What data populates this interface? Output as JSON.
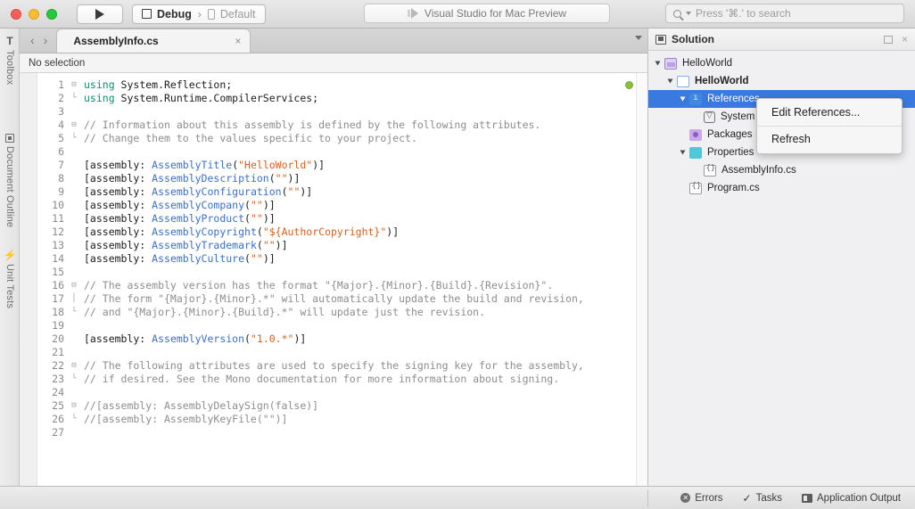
{
  "titlebar": {
    "window_controls": [
      "close",
      "minimize",
      "zoom"
    ],
    "run_button_label": "run",
    "run_icon": "play-icon",
    "configuration": "Debug",
    "config_separator": "›",
    "device": "Default",
    "app_title": "Visual Studio for Mac Preview",
    "app_icon": "visual-studio-icon",
    "search_placeholder": "Press '⌘.' to search",
    "search_icon": "search-icon"
  },
  "left_pads": [
    {
      "label": "Toolbox",
      "icon": "toolbox-icon",
      "glyph": "T"
    },
    {
      "label": "Document Outline",
      "icon": "document-outline-icon"
    },
    {
      "label": "Unit Tests",
      "icon": "unit-tests-icon",
      "glyph": "⚡"
    }
  ],
  "editor": {
    "nav_back": "‹",
    "nav_forward": "›",
    "tab_name": "AssemblyInfo.cs",
    "tab_close": "×",
    "tab_dropdown_icon": "chevron-down-icon",
    "selection_status": "No selection",
    "marker": "green-status-dot",
    "lines": [
      {
        "n": "1",
        "fold": "⊟",
        "tokens": [
          {
            "t": "using",
            "c": "k-using"
          },
          {
            "t": " System.Reflection;",
            "c": "k-plain"
          }
        ]
      },
      {
        "n": "2",
        "fold": "└",
        "tokens": [
          {
            "t": "using",
            "c": "k-using"
          },
          {
            "t": " System.Runtime.CompilerServices;",
            "c": "k-plain"
          }
        ]
      },
      {
        "n": "3",
        "fold": "",
        "tokens": []
      },
      {
        "n": "4",
        "fold": "⊟",
        "tokens": [
          {
            "t": "// Information about this assembly is defined by the following attributes.",
            "c": "k-cmt"
          }
        ]
      },
      {
        "n": "5",
        "fold": "└",
        "tokens": [
          {
            "t": "// Change them to the values specific to your project.",
            "c": "k-cmt"
          }
        ]
      },
      {
        "n": "6",
        "fold": "",
        "tokens": []
      },
      {
        "n": "7",
        "fold": "",
        "tokens": [
          {
            "t": "[assembly: ",
            "c": "k-plain"
          },
          {
            "t": "AssemblyTitle",
            "c": "k-type"
          },
          {
            "t": "(",
            "c": "k-plain"
          },
          {
            "t": "\"HelloWorld\"",
            "c": "k-str"
          },
          {
            "t": ")]",
            "c": "k-plain"
          }
        ]
      },
      {
        "n": "8",
        "fold": "",
        "tokens": [
          {
            "t": "[assembly: ",
            "c": "k-plain"
          },
          {
            "t": "AssemblyDescription",
            "c": "k-type"
          },
          {
            "t": "(",
            "c": "k-plain"
          },
          {
            "t": "\"\"",
            "c": "k-str"
          },
          {
            "t": ")]",
            "c": "k-plain"
          }
        ]
      },
      {
        "n": "9",
        "fold": "",
        "tokens": [
          {
            "t": "[assembly: ",
            "c": "k-plain"
          },
          {
            "t": "AssemblyConfiguration",
            "c": "k-type"
          },
          {
            "t": "(",
            "c": "k-plain"
          },
          {
            "t": "\"\"",
            "c": "k-str"
          },
          {
            "t": ")]",
            "c": "k-plain"
          }
        ]
      },
      {
        "n": "10",
        "fold": "",
        "tokens": [
          {
            "t": "[assembly: ",
            "c": "k-plain"
          },
          {
            "t": "AssemblyCompany",
            "c": "k-type"
          },
          {
            "t": "(",
            "c": "k-plain"
          },
          {
            "t": "\"\"",
            "c": "k-str"
          },
          {
            "t": ")]",
            "c": "k-plain"
          }
        ]
      },
      {
        "n": "11",
        "fold": "",
        "tokens": [
          {
            "t": "[assembly: ",
            "c": "k-plain"
          },
          {
            "t": "AssemblyProduct",
            "c": "k-type"
          },
          {
            "t": "(",
            "c": "k-plain"
          },
          {
            "t": "\"\"",
            "c": "k-str"
          },
          {
            "t": ")]",
            "c": "k-plain"
          }
        ]
      },
      {
        "n": "12",
        "fold": "",
        "tokens": [
          {
            "t": "[assembly: ",
            "c": "k-plain"
          },
          {
            "t": "AssemblyCopyright",
            "c": "k-type"
          },
          {
            "t": "(",
            "c": "k-plain"
          },
          {
            "t": "\"${AuthorCopyright}\"",
            "c": "k-str"
          },
          {
            "t": ")]",
            "c": "k-plain"
          }
        ]
      },
      {
        "n": "13",
        "fold": "",
        "tokens": [
          {
            "t": "[assembly: ",
            "c": "k-plain"
          },
          {
            "t": "AssemblyTrademark",
            "c": "k-type"
          },
          {
            "t": "(",
            "c": "k-plain"
          },
          {
            "t": "\"\"",
            "c": "k-str"
          },
          {
            "t": ")]",
            "c": "k-plain"
          }
        ]
      },
      {
        "n": "14",
        "fold": "",
        "tokens": [
          {
            "t": "[assembly: ",
            "c": "k-plain"
          },
          {
            "t": "AssemblyCulture",
            "c": "k-type"
          },
          {
            "t": "(",
            "c": "k-plain"
          },
          {
            "t": "\"\"",
            "c": "k-str"
          },
          {
            "t": ")]",
            "c": "k-plain"
          }
        ]
      },
      {
        "n": "15",
        "fold": "",
        "tokens": []
      },
      {
        "n": "16",
        "fold": "⊟",
        "tokens": [
          {
            "t": "// The assembly version has the format \"{Major}.{Minor}.{Build}.{Revision}\".",
            "c": "k-cmt"
          }
        ]
      },
      {
        "n": "17",
        "fold": "│",
        "tokens": [
          {
            "t": "// The form \"{Major}.{Minor}.*\" will automatically update the build and revision,",
            "c": "k-cmt"
          }
        ]
      },
      {
        "n": "18",
        "fold": "└",
        "tokens": [
          {
            "t": "// and \"{Major}.{Minor}.{Build}.*\" will update just the revision.",
            "c": "k-cmt"
          }
        ]
      },
      {
        "n": "19",
        "fold": "",
        "tokens": []
      },
      {
        "n": "20",
        "fold": "",
        "tokens": [
          {
            "t": "[assembly: ",
            "c": "k-plain"
          },
          {
            "t": "AssemblyVersion",
            "c": "k-type"
          },
          {
            "t": "(",
            "c": "k-plain"
          },
          {
            "t": "\"1.0.*\"",
            "c": "k-str"
          },
          {
            "t": ")]",
            "c": "k-plain"
          }
        ]
      },
      {
        "n": "21",
        "fold": "",
        "tokens": []
      },
      {
        "n": "22",
        "fold": "⊟",
        "tokens": [
          {
            "t": "// The following attributes are used to specify the signing key for the assembly,",
            "c": "k-cmt"
          }
        ]
      },
      {
        "n": "23",
        "fold": "└",
        "tokens": [
          {
            "t": "// if desired. See the Mono documentation for more information about signing.",
            "c": "k-cmt"
          }
        ]
      },
      {
        "n": "24",
        "fold": "",
        "tokens": []
      },
      {
        "n": "25",
        "fold": "⊟",
        "tokens": [
          {
            "t": "//[assembly: AssemblyDelaySign(false)]",
            "c": "k-cmt"
          }
        ]
      },
      {
        "n": "26",
        "fold": "└",
        "tokens": [
          {
            "t": "//[assembly: AssemblyKeyFile(\"\")]",
            "c": "k-cmt"
          }
        ]
      },
      {
        "n": "27",
        "fold": "",
        "tokens": []
      }
    ]
  },
  "solution": {
    "title": "Solution",
    "header_icon": "solution-icon",
    "dock_icon": "dock-icon",
    "close_icon": "close-icon",
    "tree": [
      {
        "label": "HelloWorld",
        "icon": "solution-node-icon",
        "indent": "ind1",
        "twist": true,
        "bold": false,
        "selected": false
      },
      {
        "label": "HelloWorld",
        "icon": "project-icon",
        "indent": "ind2",
        "twist": true,
        "bold": true,
        "selected": false
      },
      {
        "label": "References",
        "icon": "references-folder-icon",
        "indent": "ind3",
        "twist": true,
        "bold": false,
        "selected": true
      },
      {
        "label": "System",
        "icon": "assembly-icon",
        "indent": "ind4",
        "twist": false,
        "bold": false,
        "selected": false
      },
      {
        "label": "Packages",
        "icon": "packages-folder-icon",
        "indent": "ind3",
        "twist": false,
        "bold": false,
        "selected": false
      },
      {
        "label": "Properties",
        "icon": "properties-folder-icon",
        "indent": "ind3",
        "twist": true,
        "bold": false,
        "selected": false
      },
      {
        "label": "AssemblyInfo.cs",
        "icon": "csharp-file-icon",
        "indent": "ind4",
        "twist": false,
        "bold": false,
        "selected": false
      },
      {
        "label": "Program.cs",
        "icon": "csharp-file-icon",
        "indent": "ind3",
        "twist": false,
        "bold": false,
        "selected": false
      }
    ]
  },
  "context_menu": {
    "items": [
      {
        "label": "Edit References..."
      },
      {
        "label": "Refresh"
      }
    ]
  },
  "statusbar": {
    "items": [
      {
        "label": "Errors",
        "icon": "errors-icon",
        "glyph": "✕"
      },
      {
        "label": "Tasks",
        "icon": "tasks-icon",
        "glyph": "✓"
      },
      {
        "label": "Application Output",
        "icon": "application-output-icon"
      }
    ]
  },
  "colors": {
    "accent_selection": "#3a7ae0",
    "keyword": "#0a8d6e",
    "type": "#3b6fc4",
    "string": "#d4601e",
    "comment": "#8d8d8d",
    "status_dot": "#8cbf3f"
  }
}
